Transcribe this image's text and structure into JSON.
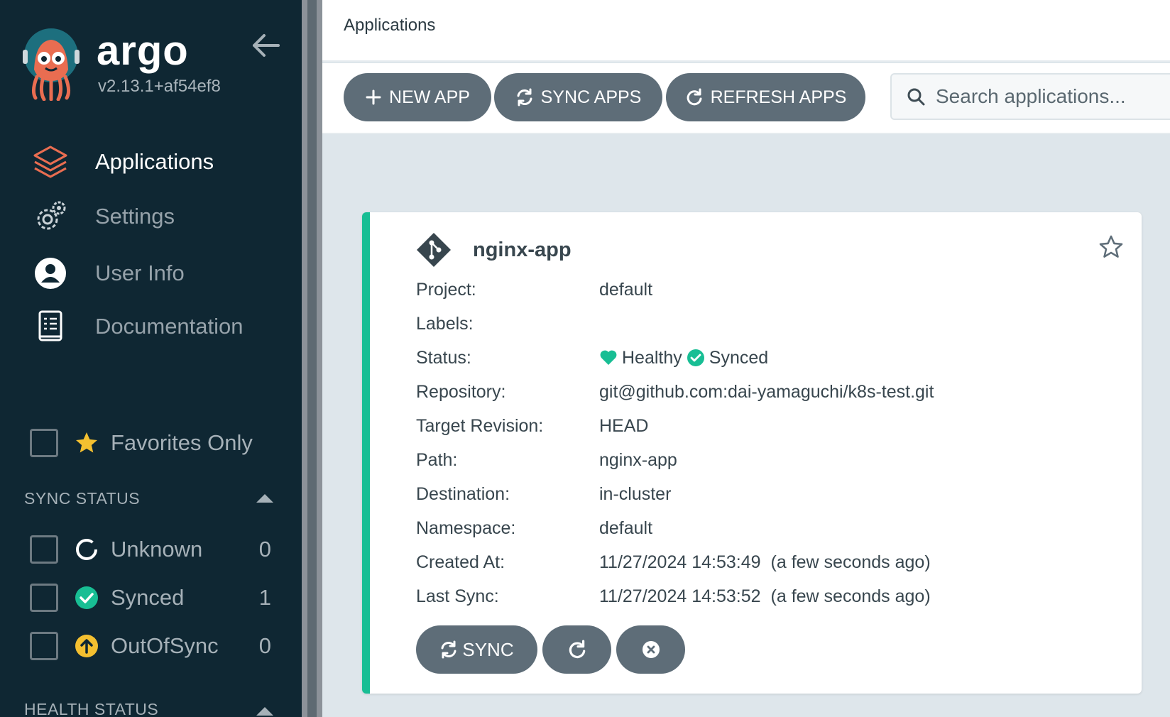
{
  "sidebar": {
    "brand": "argo",
    "version": "v2.13.1+af54ef8",
    "nav": [
      {
        "label": "Applications"
      },
      {
        "label": "Settings"
      },
      {
        "label": "User Info"
      },
      {
        "label": "Documentation"
      }
    ],
    "favorites_label": "Favorites Only",
    "sync_status": {
      "title": "SYNC STATUS",
      "items": [
        {
          "label": "Unknown",
          "count": "0"
        },
        {
          "label": "Synced",
          "count": "1"
        },
        {
          "label": "OutOfSync",
          "count": "0"
        }
      ]
    },
    "health_status_title": "HEALTH STATUS"
  },
  "header": {
    "title": "Applications"
  },
  "toolbar": {
    "new_app": "NEW APP",
    "sync_apps": "SYNC APPS",
    "refresh_apps": "REFRESH APPS",
    "search_placeholder": "Search applications..."
  },
  "app": {
    "name": "nginx-app",
    "fields": {
      "project": {
        "label": "Project:",
        "value": "default"
      },
      "labels": {
        "label": "Labels:",
        "value": ""
      },
      "status": {
        "label": "Status:",
        "health": "Healthy",
        "sync": "Synced"
      },
      "repository": {
        "label": "Repository:",
        "value": "git@github.com:dai-yamaguchi/k8s-test.git"
      },
      "target_revision": {
        "label": "Target Revision:",
        "value": "HEAD"
      },
      "path": {
        "label": "Path:",
        "value": "nginx-app"
      },
      "destination": {
        "label": "Destination:",
        "value": "in-cluster"
      },
      "namespace": {
        "label": "Namespace:",
        "value": "default"
      },
      "created_at": {
        "label": "Created At:",
        "value": "11/27/2024 14:53:49",
        "relative": "(a few seconds ago)"
      },
      "last_sync": {
        "label": "Last Sync:",
        "value": "11/27/2024 14:53:52",
        "relative": "(a few seconds ago)"
      }
    },
    "sync_button": "SYNC"
  },
  "colors": {
    "sidebar_bg": "#0f2733",
    "accent_green": "#18be94",
    "button_gray": "#5e6d78",
    "argo_orange": "#e96d51",
    "warning_yellow": "#f4c030"
  }
}
